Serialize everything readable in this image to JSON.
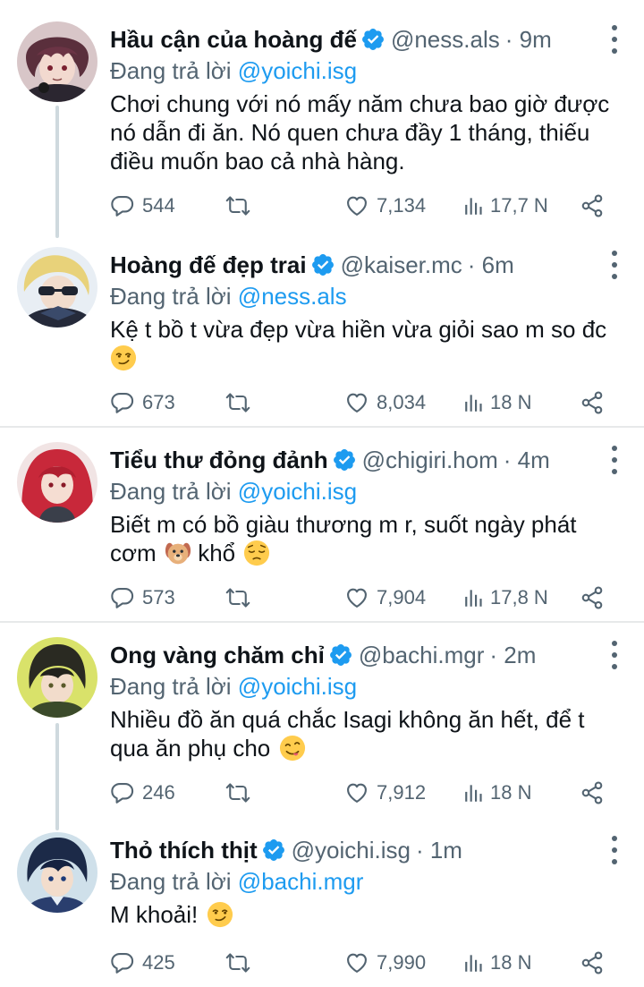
{
  "reply_prefix": "Đang trả lời",
  "colors": {
    "accent": "#1d9bf0",
    "muted": "#536471",
    "text": "#0f1419",
    "divider": "#e7e9ea"
  },
  "icons": {
    "reply": "comment-icon",
    "retweet": "retweet-icon",
    "like": "heart-icon",
    "views": "views-icon",
    "share": "share-icon",
    "more": "more-vertical-icon",
    "verified": "verified-badge-icon"
  },
  "tweets": [
    {
      "name": "Hầu cận của hoàng đế",
      "handle": "@ness.als",
      "time": "· 9m",
      "reply_to": "@yoichi.isg",
      "text": "Chơi chung với nó mấy năm chưa bao giờ được nó dẫn đi ăn. Nó quen chưa đầy 1 tháng, thiếu điều muốn bao cả nhà hàng.",
      "emoji": [],
      "replies": "544",
      "likes": "7,134",
      "views": "17,7 N"
    },
    {
      "name": "Hoàng đế đẹp trai",
      "handle": "@kaiser.mc",
      "time": "· 6m",
      "reply_to": "@ness.als",
      "text": "Kệ t bồ t vừa đẹp vừa hiền vừa giỏi sao m so đc",
      "emoji": [
        "smirking-face-emoji"
      ],
      "replies": "673",
      "likes": "8,034",
      "views": "18 N"
    },
    {
      "name": "Tiểu thư đỏng đảnh",
      "handle": "@chigiri.hom",
      "time": "· 4m",
      "reply_to": "@yoichi.isg",
      "text_a": "Biết m có bồ giàu thương m r, suốt ngày phát cơm",
      "text_b": "khổ",
      "emoji": [
        "dog-face-emoji",
        "pensive-face-emoji"
      ],
      "replies": "573",
      "likes": "7,904",
      "views": "17,8 N"
    },
    {
      "name": "Ong vàng chăm chỉ",
      "handle": "@bachi.mgr",
      "time": "· 2m",
      "reply_to": "@yoichi.isg",
      "text": "Nhiều đồ ăn quá chắc Isagi không ăn hết, để t qua ăn phụ cho",
      "emoji": [
        "yummy-face-emoji"
      ],
      "replies": "246",
      "likes": "7,912",
      "views": "18 N"
    },
    {
      "name": "Thỏ thích thịt",
      "handle": "@yoichi.isg",
      "time": "· 1m",
      "reply_to": "@bachi.mgr",
      "text": "M khoải!",
      "emoji": [
        "smirking-face-emoji"
      ],
      "replies": "425",
      "likes": "7,990",
      "views": "18 N"
    }
  ]
}
